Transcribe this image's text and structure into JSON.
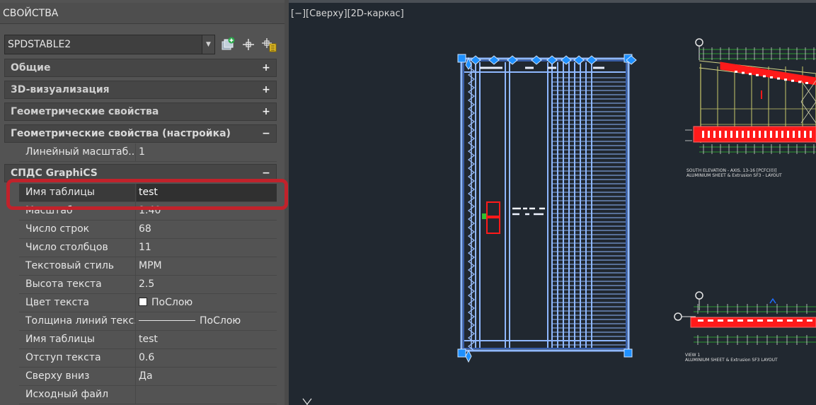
{
  "palette": {
    "title": "СВОЙСТВА",
    "object_type": "SPDSTABLE2",
    "tools": [
      {
        "name": "toggle-pickadd-icon"
      },
      {
        "name": "select-objects-icon"
      },
      {
        "name": "quick-select-icon"
      }
    ]
  },
  "sections": [
    {
      "label": "Общие",
      "state": "collapsed",
      "toggle": "+"
    },
    {
      "label": "3D-визуализация",
      "state": "collapsed",
      "toggle": "+"
    },
    {
      "label": "Геометрические свойства",
      "state": "collapsed",
      "toggle": "+"
    },
    {
      "label": "Геометрические свойства (настройка)",
      "state": "expanded",
      "toggle": "−"
    },
    {
      "label": "СПДС GraphiCS",
      "state": "expanded",
      "toggle": "−"
    }
  ],
  "geometry_props": [
    {
      "name": "Линейный масштаб...",
      "value": "1"
    }
  ],
  "spds_props": [
    {
      "name": "Имя таблицы",
      "value": "test"
    },
    {
      "name": "Масштаб",
      "value": "1:40"
    },
    {
      "name": "Число строк",
      "value": "68"
    },
    {
      "name": "Число столбцов",
      "value": "11"
    },
    {
      "name": "Текстовый стиль",
      "value": "МРМ"
    },
    {
      "name": "Высота текста",
      "value": "2.5"
    },
    {
      "name": "Цвет текста",
      "value": "ПоСлою"
    },
    {
      "name": "Толщина линий текс...",
      "value": "ПоСлою"
    },
    {
      "name": "Имя таблицы",
      "value": "test"
    },
    {
      "name": "Отступ текста",
      "value": "0.6"
    },
    {
      "name": "Сверху вниз",
      "value": "Да"
    },
    {
      "name": "Исходный файл",
      "value": ""
    }
  ],
  "viewport": {
    "controls": [
      "[−]",
      "[Сверху]",
      "[2D-каркас]"
    ]
  },
  "drawing": {
    "caption_top_1": "SOUTH ELEVATION - AXIS. 13-16 [PCFC(0)]",
    "caption_top_2": "ALUMINIUM SHEET & Extrusion SF3 - LAYOUT",
    "caption_bottom_1": "VIEW 1",
    "caption_bottom_2": "ALUMINIUM SHEET & Extrusion SF3   LAYOUT"
  },
  "colors": {
    "accent_highlight": "#c1222b",
    "grip": "#1e90ff",
    "selection": "#8fb8ff",
    "cad_red": "#ff1a1a",
    "cad_green": "#2fbf2f",
    "cad_yellow": "#c8c86a"
  }
}
